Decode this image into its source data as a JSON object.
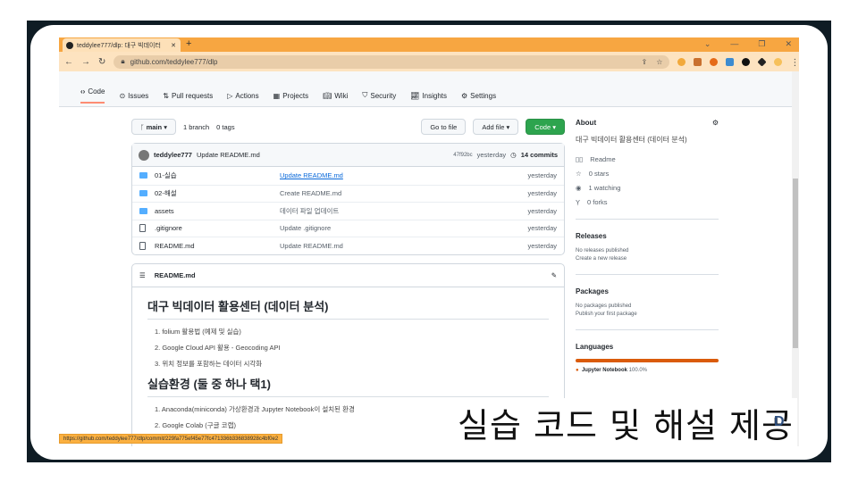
{
  "browser": {
    "tab_title": "teddylee777/dlp: 대구 빅데이터",
    "url": "github.com/teddylee777/dlp",
    "status_url": "https://github.com/teddylee777/dlp/commit/229fa775ef45e77fc471336b336838928c4bf0e2"
  },
  "repo_nav": [
    "Code",
    "Issues",
    "Pull requests",
    "Actions",
    "Projects",
    "Wiki",
    "Security",
    "Insights",
    "Settings"
  ],
  "toolbar": {
    "branch": "main",
    "branches": "1 branch",
    "tags": "0 tags",
    "go_to_file": "Go to file",
    "add_file": "Add file ▾",
    "code": "Code ▾"
  },
  "commit": {
    "author": "teddylee777",
    "message": "Update README.md",
    "hash": "47f92bc",
    "time": "yesterday",
    "commits": "14 commits"
  },
  "files": [
    {
      "name": "01-실습",
      "msg": "Update README.md",
      "time": "yesterday",
      "type": "dir"
    },
    {
      "name": "02-해설",
      "msg": "Create README.md",
      "time": "yesterday",
      "type": "dir"
    },
    {
      "name": "assets",
      "msg": "데이터 파일 업데이트",
      "time": "yesterday",
      "type": "dir"
    },
    {
      "name": ".gitignore",
      "msg": "Update .gitignore",
      "time": "yesterday",
      "type": "file"
    },
    {
      "name": "README.md",
      "msg": "Update README.md",
      "time": "yesterday",
      "type": "file"
    }
  ],
  "readme": {
    "file": "README.md",
    "h1": "대구 빅데이터 활용센터 (데이터 분석)",
    "list1": [
      "1. folium 활용법 (예제 및 실습)",
      "2. Google Cloud API 활용 - Geocoding API",
      "3. 위치 정보를 포함하는 데이터 시각화"
    ],
    "h2": "실습환경 (둘 중 하나 택1)",
    "list2": [
      "1. Anaconda(miniconda) 가상환경과 Jupyter Notebook이 설치된 환경",
      "2. Google Colab (구글 코랩)"
    ]
  },
  "about": {
    "title": "About",
    "desc": "대구 빅데이터 활용센터 (데이터 분석)",
    "readme": "Readme",
    "stars": "0 stars",
    "watching": "1 watching",
    "forks": "0 forks"
  },
  "releases": {
    "title": "Releases",
    "none": "No releases published",
    "link": "Create a new release"
  },
  "packages": {
    "title": "Packages",
    "none": "No packages published",
    "link": "Publish your first package"
  },
  "languages": {
    "title": "Languages",
    "name": "Jupyter Notebook",
    "pct": "100.0%",
    "color": "#da5b0b"
  },
  "caption": "실습 코드 및 해설 제공",
  "logo": "D"
}
